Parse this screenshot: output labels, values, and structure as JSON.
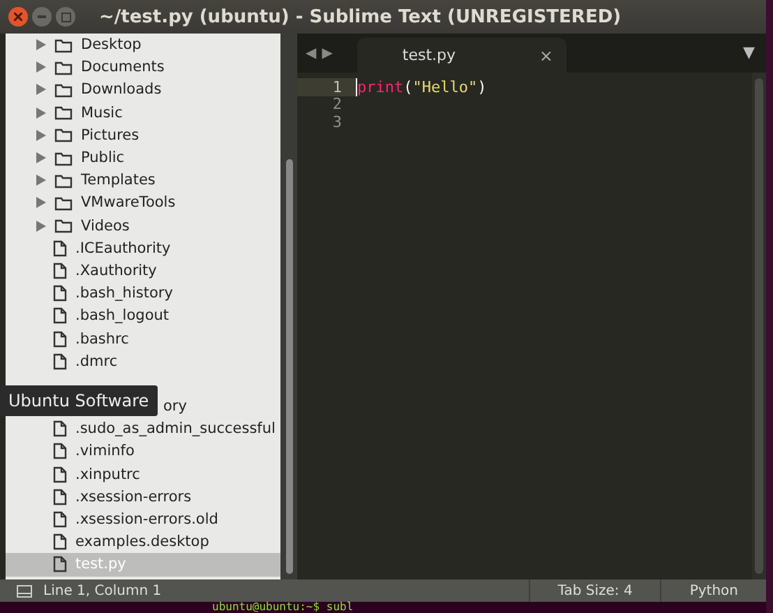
{
  "window": {
    "title": "~/test.py (ubuntu) - Sublime Text (UNREGISTERED)"
  },
  "sidebar": {
    "items": [
      {
        "kind": "folder",
        "name": "Desktop",
        "selected": false
      },
      {
        "kind": "folder",
        "name": "Documents",
        "selected": false
      },
      {
        "kind": "folder",
        "name": "Downloads",
        "selected": false
      },
      {
        "kind": "folder",
        "name": "Music",
        "selected": false
      },
      {
        "kind": "folder",
        "name": "Pictures",
        "selected": false
      },
      {
        "kind": "folder",
        "name": "Public",
        "selected": false
      },
      {
        "kind": "folder",
        "name": "Templates",
        "selected": false
      },
      {
        "kind": "folder",
        "name": "VMwareTools",
        "selected": false
      },
      {
        "kind": "folder",
        "name": "Videos",
        "selected": false
      },
      {
        "kind": "file",
        "name": ".ICEauthority",
        "selected": false
      },
      {
        "kind": "file",
        "name": ".Xauthority",
        "selected": false
      },
      {
        "kind": "file",
        "name": ".bash_history",
        "selected": false
      },
      {
        "kind": "file",
        "name": ".bash_logout",
        "selected": false
      },
      {
        "kind": "file",
        "name": ".bashrc",
        "selected": false
      },
      {
        "kind": "file",
        "name": ".dmrc",
        "selected": false
      },
      {
        "kind": "covered",
        "selected": false
      },
      {
        "kind": "covered",
        "name": "ory",
        "selected": false
      },
      {
        "kind": "file",
        "name": ".sudo_as_admin_successful",
        "selected": false
      },
      {
        "kind": "file",
        "name": ".viminfo",
        "selected": false
      },
      {
        "kind": "file",
        "name": ".xinputrc",
        "selected": false
      },
      {
        "kind": "file",
        "name": ".xsession-errors",
        "selected": false
      },
      {
        "kind": "file",
        "name": ".xsession-errors.old",
        "selected": false
      },
      {
        "kind": "file",
        "name": "examples.desktop",
        "selected": false
      },
      {
        "kind": "file",
        "name": "test.py",
        "selected": true
      }
    ]
  },
  "tooltip": "Ubuntu Software",
  "tabs": [
    {
      "label": "test.py",
      "close": "×",
      "selected": true
    }
  ],
  "tab_nav": {
    "prev": "◀",
    "next": "▶",
    "menu": "▼"
  },
  "editor": {
    "lines": [
      {
        "number": "1",
        "current": true,
        "tokens": [
          {
            "kind": "builtin",
            "text": "print"
          },
          {
            "kind": "plain",
            "text": "("
          },
          {
            "kind": "string",
            "text": "\"Hello\""
          },
          {
            "kind": "plain",
            "text": ")"
          }
        ]
      },
      {
        "number": "2",
        "current": false
      },
      {
        "number": "3",
        "current": false
      }
    ]
  },
  "status_bar": {
    "position": "Line 1, Column 1",
    "tab_size": "Tab Size: 4",
    "syntax": "Python"
  },
  "terminal": "ubuntu@ubuntu:~$ subl"
}
